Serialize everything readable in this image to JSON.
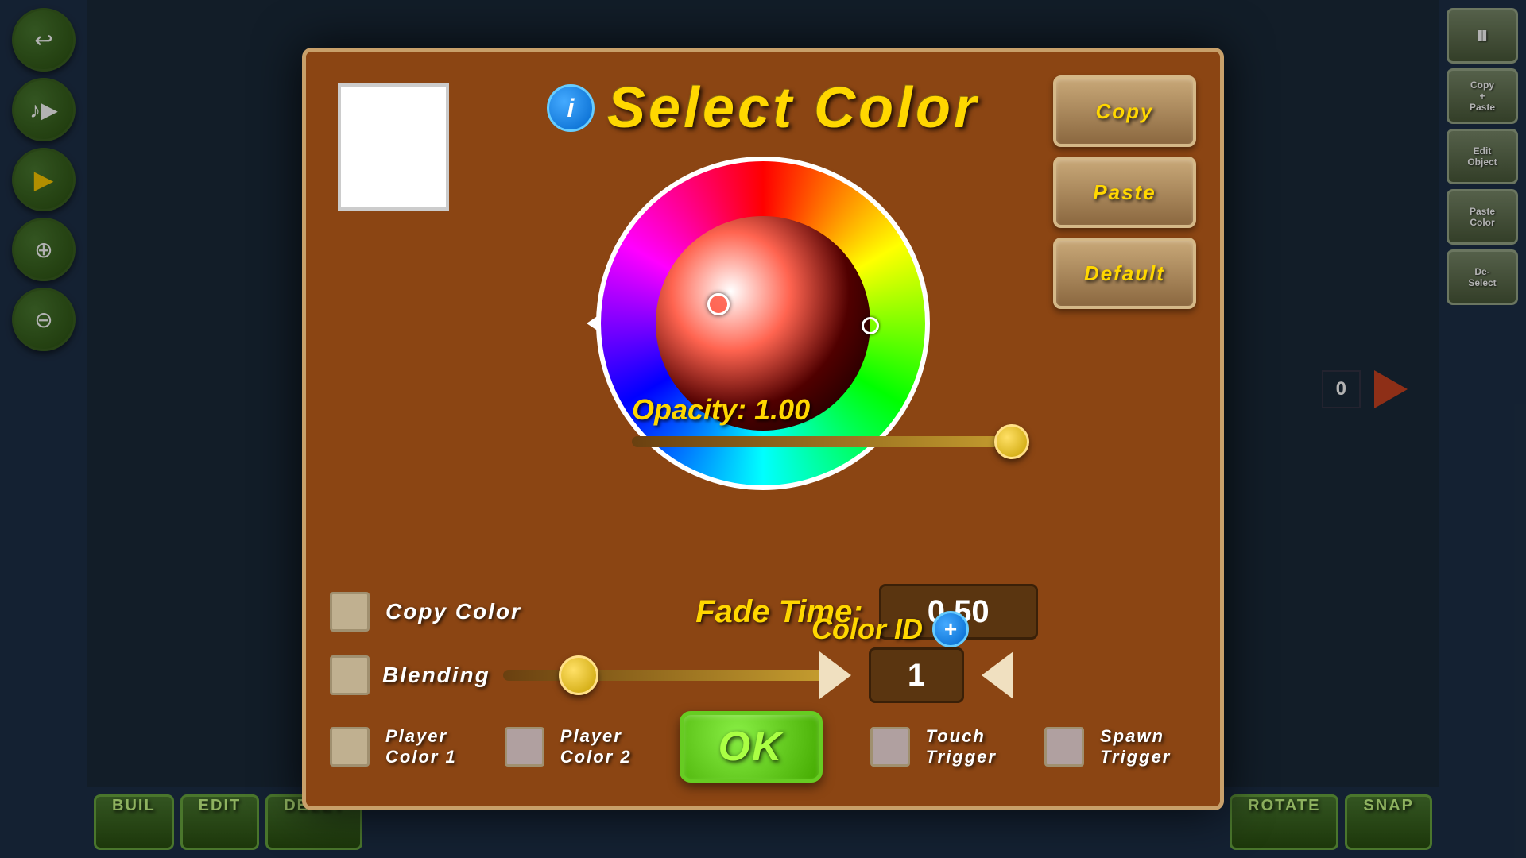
{
  "modal": {
    "title": "Select Color",
    "info_icon": "i",
    "buttons": {
      "copy": "Copy",
      "paste": "Paste",
      "default": "Default",
      "ok": "OK"
    }
  },
  "opacity": {
    "label": "Opacity: 1.00",
    "value": 1.0
  },
  "fade_time": {
    "label": "Fade Time:",
    "value": "0.50"
  },
  "color_id": {
    "label": "Color ID",
    "value": "1"
  },
  "controls": {
    "copy_color": "Copy Color",
    "blending": "Blending",
    "player_color_1": "Player\nColor 1",
    "player_color_2": "Player\nColor 2",
    "touch_trigger": "Touch\nTrigger",
    "spawn_trigger": "Spawn\nTrigger"
  },
  "sidebar": {
    "buttons": [
      "↩",
      "♪",
      "▶",
      "⊕",
      "⊖"
    ]
  },
  "right_sidebar": {
    "buttons": [
      "Copy\n+\nPaste",
      "Edit\nObject",
      "Paste\nColor",
      "De-\nSelect"
    ]
  },
  "bottom": {
    "build": "BUIL",
    "edit": "EDIT",
    "delete": "DELET",
    "rotate": "ROTATE",
    "snap": "SNAP"
  },
  "counter": {
    "value": "0"
  }
}
